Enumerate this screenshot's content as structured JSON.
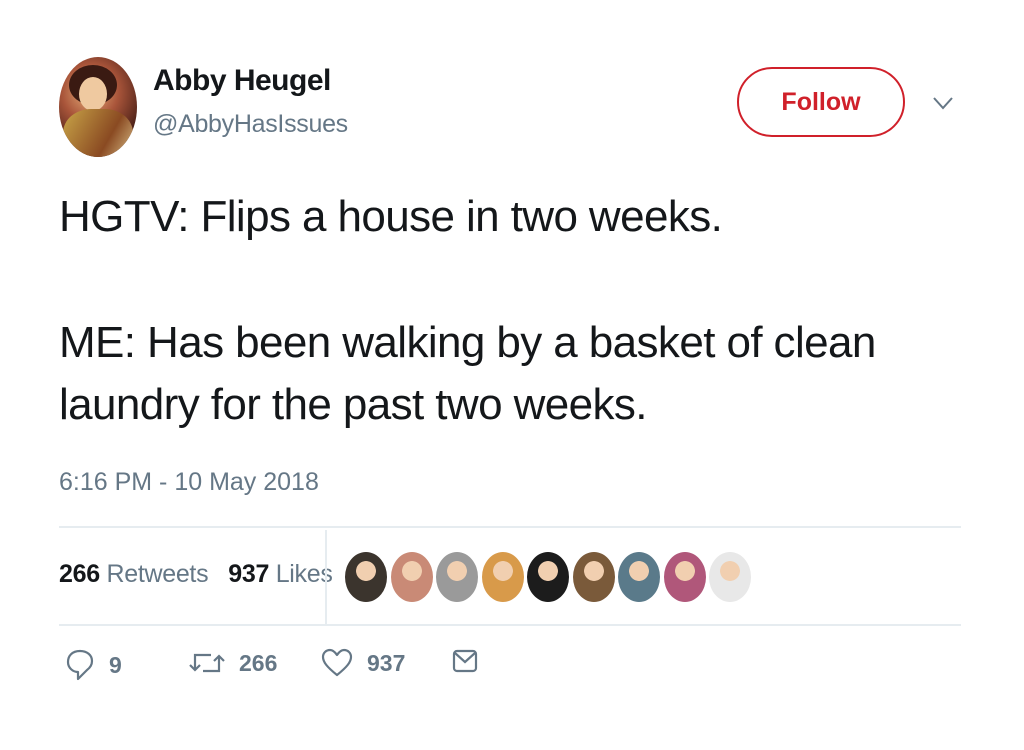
{
  "tweet": {
    "author_name": "Abby Heugel",
    "author_handle": "@AbbyHasIssues",
    "follow_label": "Follow",
    "text_line1": "HGTV: Flips a house in two weeks.",
    "text_line2": "ME: Has been walking by a basket of clean\nlaundry for the past two weeks.",
    "timestamp": "6:16 PM - 10 May 2018"
  },
  "stats": {
    "retweets_count": "266",
    "retweets_label": "Retweets",
    "likes_count": "937",
    "likes_label": "Likes"
  },
  "likers": [
    {
      "name": "liker-1",
      "color": "#3b342d"
    },
    {
      "name": "liker-2",
      "color": "#c98a76"
    },
    {
      "name": "liker-3",
      "color": "#9a9a9a"
    },
    {
      "name": "liker-4",
      "color": "#d89a4a"
    },
    {
      "name": "liker-5",
      "color": "#1c1c1c"
    },
    {
      "name": "liker-6",
      "color": "#7a5a3a"
    },
    {
      "name": "liker-7",
      "color": "#5a7a8a"
    },
    {
      "name": "liker-8",
      "color": "#b0577a"
    },
    {
      "name": "liker-9",
      "color": "#e8e8e8"
    }
  ],
  "actions": {
    "reply_count": "9",
    "retweet_count": "266",
    "like_count": "937"
  },
  "colors": {
    "accent": "#d0202a",
    "muted": "#657786",
    "text": "#14171a",
    "divider": "#e6ecf0"
  },
  "icons": [
    "reply-icon",
    "retweet-icon",
    "like-icon",
    "message-icon",
    "chevron-down-icon"
  ]
}
